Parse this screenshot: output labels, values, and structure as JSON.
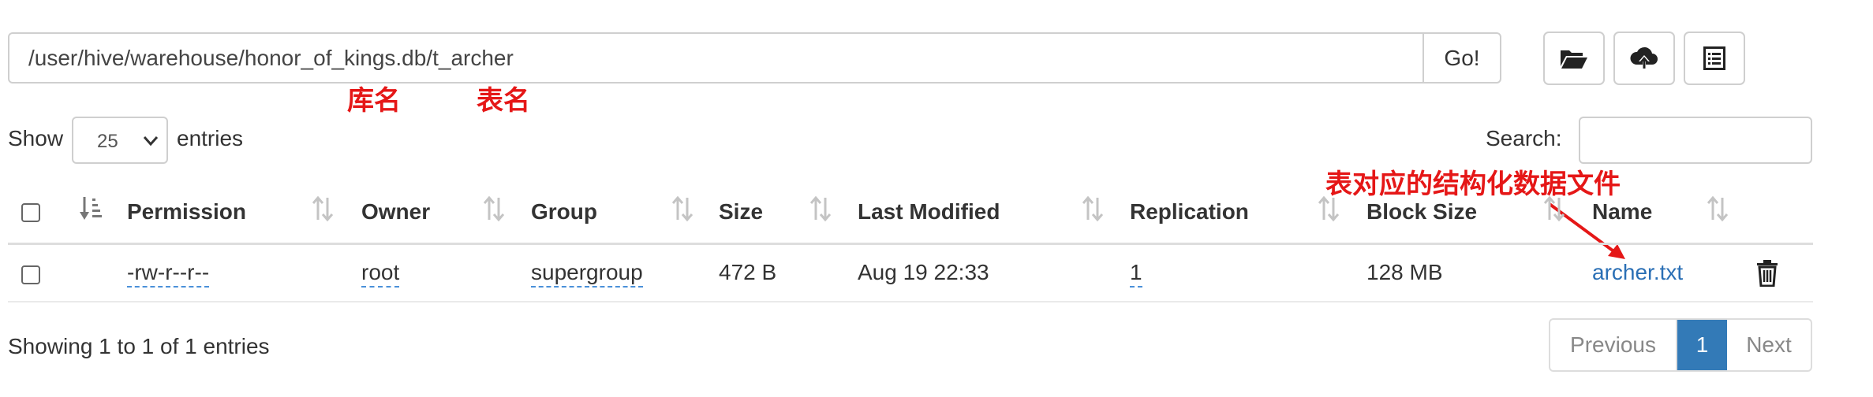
{
  "path": {
    "value": "/user/hive/warehouse/honor_of_kings.db/t_archer",
    "go_label": "Go!"
  },
  "toolbar": {
    "icons": [
      "folder-open-icon",
      "cloud-upload-icon",
      "list-icon"
    ]
  },
  "annotations": {
    "db_name": "库名",
    "table_name": "表名",
    "file_note": "表对应的结构化数据文件"
  },
  "length": {
    "show": "Show",
    "value": "25",
    "entries": "entries"
  },
  "search": {
    "label": "Search:",
    "value": ""
  },
  "table": {
    "headers": [
      "Permission",
      "Owner",
      "Group",
      "Size",
      "Last Modified",
      "Replication",
      "Block Size",
      "Name"
    ],
    "rows": [
      {
        "permission": "-rw-r--r--",
        "owner": "root",
        "group": "supergroup",
        "size": "472 B",
        "modified": "Aug 19 22:33",
        "replication": "1",
        "block_size": "128 MB",
        "name": "archer.txt"
      }
    ]
  },
  "footer": {
    "info": "Showing 1 to 1 of 1 entries",
    "previous": "Previous",
    "current_page": "1",
    "next": "Next"
  },
  "colors": {
    "accent": "#337ab7",
    "annotation": "#e51717",
    "link": "#2a6fb5"
  }
}
